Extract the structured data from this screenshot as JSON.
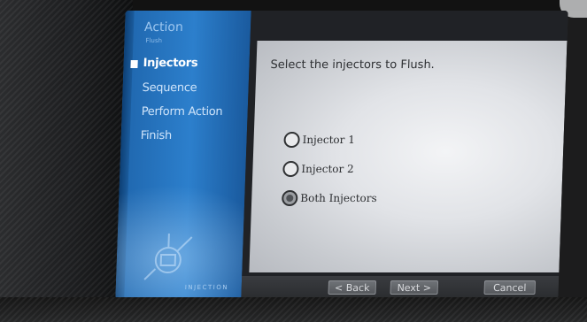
{
  "wizard": {
    "header_title": "Action",
    "header_subtitle": "Flush",
    "steps": [
      {
        "label": "Injectors",
        "active": true
      },
      {
        "label": "Sequence",
        "active": false
      },
      {
        "label": "Perform Action",
        "active": false
      },
      {
        "label": "Finish",
        "active": false
      }
    ],
    "brand": "INJECTION"
  },
  "content": {
    "prompt": "Select the injectors to Flush.",
    "options": [
      {
        "label": "Injector 1",
        "selected": false
      },
      {
        "label": "Injector 2",
        "selected": false
      },
      {
        "label": "Both Injectors",
        "selected": true
      }
    ]
  },
  "footer": {
    "back_label": "< Back",
    "next_label": "Next >",
    "cancel_label": "Cancel"
  },
  "colors": {
    "sidebar_blue": "#2c7fcc",
    "content_bg": "#e1e3e7",
    "footer_bg": "#2a2c2f"
  }
}
